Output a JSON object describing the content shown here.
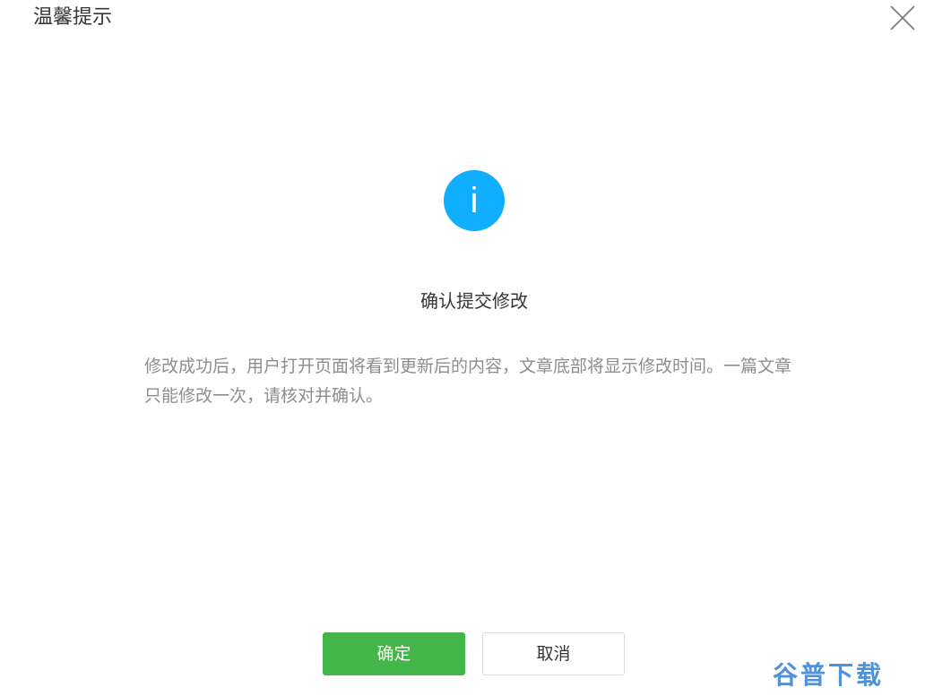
{
  "dialog": {
    "title": "温馨提示",
    "close_icon": "close-icon",
    "info_icon": "info-icon",
    "info_glyph": "i",
    "heading": "确认提交修改",
    "message": "修改成功后，用户打开页面将看到更新后的内容，文章底部将显示修改时间。一篇文章只能修改一次，请核对并确认。",
    "buttons": {
      "ok_label": "确定",
      "cancel_label": "取消"
    }
  },
  "watermark": {
    "text": "谷普下载"
  },
  "colors": {
    "accent_green": "#44b549",
    "info_blue": "#10aeff",
    "title_text": "#353535",
    "message_text": "#8d8d8d",
    "cancel_border": "#d9dadc"
  }
}
